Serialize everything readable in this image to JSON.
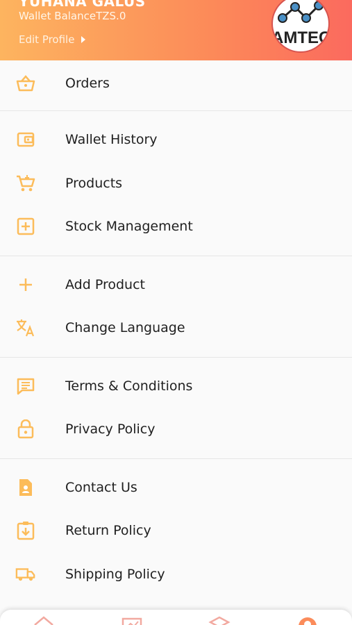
{
  "header": {
    "user_name": "YUHANA GALUS",
    "wallet_balance": "Wallet BalanceTZS.0",
    "edit_profile_label": "Edit Profile",
    "logo_text": "AMTEC"
  },
  "menu": {
    "orders": "Orders",
    "wallet_history": "Wallet History",
    "products": "Products",
    "stock_management": "Stock Management",
    "add_product": "Add Product",
    "change_language": "Change Language",
    "terms": "Terms & Conditions",
    "privacy": "Privacy Policy",
    "contact": "Contact Us",
    "return_policy": "Return Policy",
    "shipping_policy": "Shipping Policy"
  },
  "icons": {
    "orders": "basket-icon",
    "wallet_history": "wallet-icon",
    "products": "cart-icon",
    "stock_management": "plus-box-icon",
    "add_product": "plus-icon",
    "change_language": "translate-icon",
    "terms": "chat-list-icon",
    "privacy": "lock-icon",
    "contact": "contact-card-icon",
    "return_policy": "clipboard-download-icon",
    "shipping_policy": "truck-icon"
  },
  "colors": {
    "accent": "#fcbc5a",
    "header_start": "#fdb45f",
    "header_end": "#fb6a5e",
    "text": "#1f1f1f"
  }
}
